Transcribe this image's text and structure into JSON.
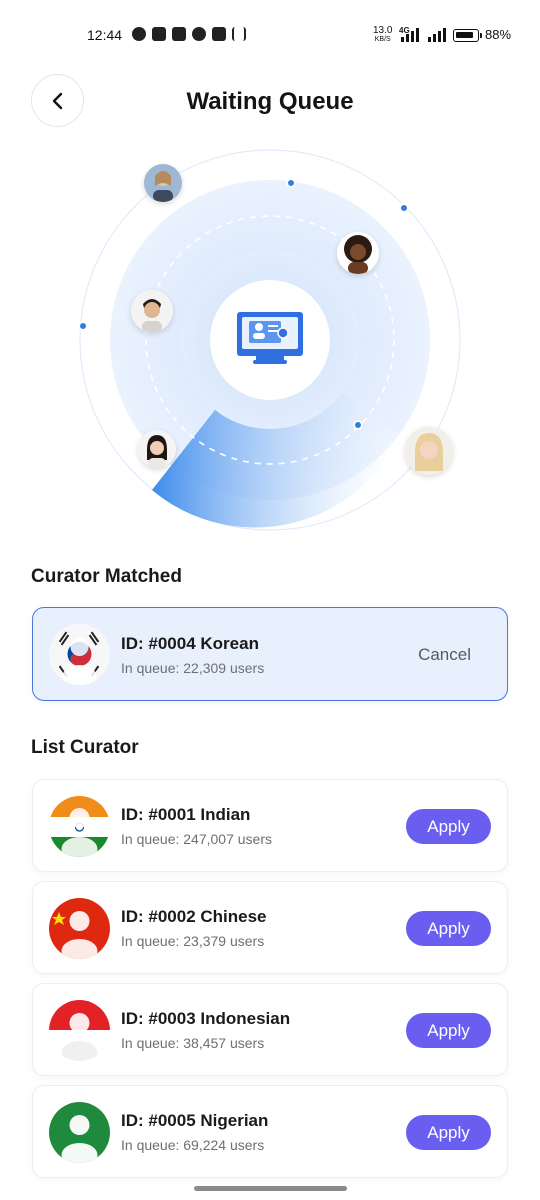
{
  "status_bar": {
    "time": "12:44",
    "net_speed_value": "13.0",
    "net_speed_unit": "KB/S",
    "network": "4G",
    "battery": "88%"
  },
  "header": {
    "title": "Waiting Queue",
    "back_icon": "chevron-left-icon"
  },
  "radar": {
    "center_icon": "computer-with-curator-id-card-icon",
    "colors": {
      "inner": "#d6e5fb",
      "outer": "#e8f1fd",
      "sweep": "#4c93ee",
      "dot": "#2f7ee0"
    }
  },
  "matched": {
    "section_title": "Curator Matched",
    "card": {
      "flag": "korea",
      "id_label": "ID: #0004 Korean",
      "queue_label": "In queue: 22,309 users",
      "action_label": "Cancel"
    }
  },
  "list": {
    "section_title": "List Curator",
    "items": [
      {
        "flag": "india",
        "id_label": "ID: #0001 Indian",
        "queue_label": "In queue: 247,007 users",
        "action_label": "Apply"
      },
      {
        "flag": "china",
        "id_label": "ID: #0002 Chinese",
        "queue_label": "In queue: 23,379 users",
        "action_label": "Apply"
      },
      {
        "flag": "indonesia",
        "id_label": "ID: #0003 Indonesian",
        "queue_label": "In queue: 38,457 users",
        "action_label": "Apply"
      },
      {
        "flag": "nigeria",
        "id_label": "ID: #0005 Nigerian",
        "queue_label": "In queue: 69,224 users",
        "action_label": "Apply"
      }
    ]
  },
  "colors": {
    "accent": "#6a5ef0",
    "matched_bg": "#e9f0fd",
    "matched_border": "#4a76e0"
  }
}
